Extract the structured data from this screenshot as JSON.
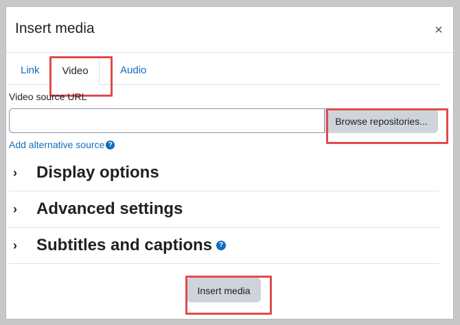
{
  "dialog": {
    "title": "Insert media",
    "close_glyph": "×"
  },
  "tabs": [
    {
      "label": "Link"
    },
    {
      "label": "Video",
      "active": true
    },
    {
      "label": "Audio"
    }
  ],
  "video": {
    "source_label": "Video source URL",
    "source_value": "",
    "browse_label": "Browse repositories...",
    "alt_source_label": "Add alternative source",
    "help_glyph": "?"
  },
  "sections": [
    {
      "title": "Display options"
    },
    {
      "title": "Advanced settings"
    },
    {
      "title": "Subtitles and captions",
      "has_help": true
    }
  ],
  "footer": {
    "insert_label": "Insert media"
  },
  "colors": {
    "link": "#0f6cbf",
    "highlight": "#e04a4a",
    "button_bg": "#ced4da"
  }
}
